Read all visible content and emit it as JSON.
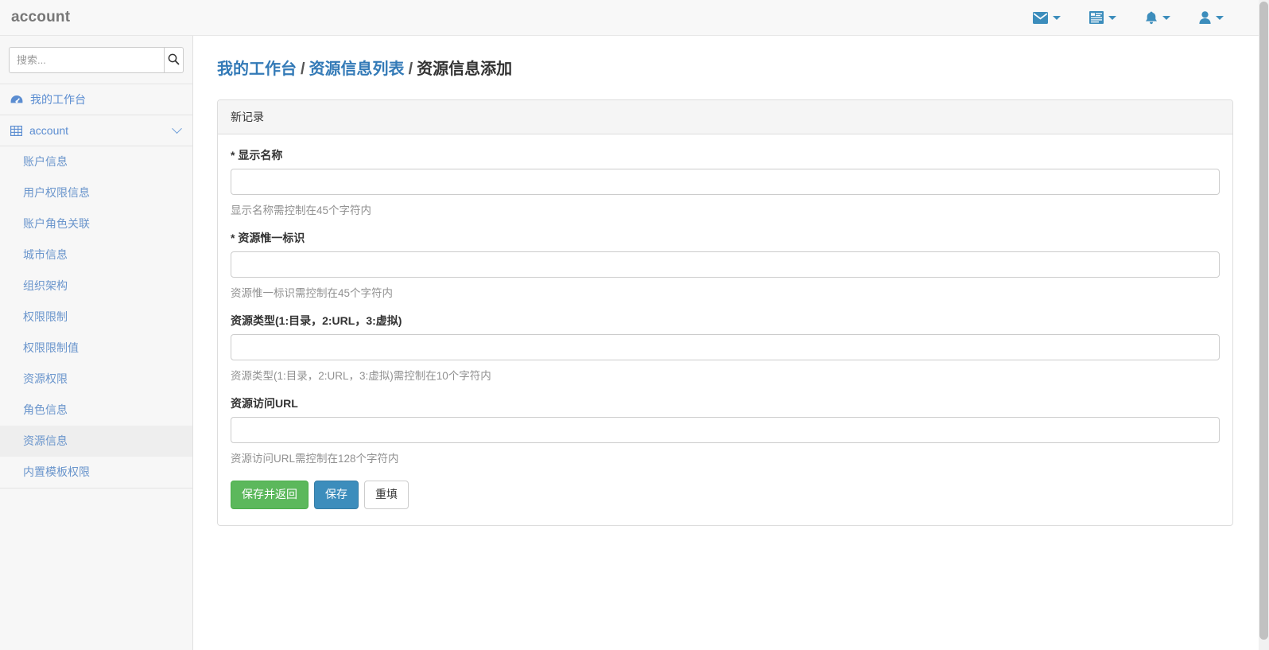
{
  "navbar": {
    "brand": "account",
    "items": [
      {
        "icon": "envelope-icon",
        "name": "messages-menu"
      },
      {
        "icon": "tasks-icon",
        "name": "tasks-menu"
      },
      {
        "icon": "bell-icon",
        "name": "notifications-menu"
      },
      {
        "icon": "user-icon",
        "name": "user-menu"
      }
    ]
  },
  "sidebar": {
    "search": {
      "placeholder": "搜索...",
      "value": "",
      "button_icon": "search-icon"
    },
    "dashboard": {
      "label": "我的工作台",
      "icon": "dashboard-icon"
    },
    "tree": {
      "label": "account",
      "icon": "table-icon",
      "chevron": "chevron-down-icon"
    },
    "items": [
      {
        "label": "账户信息",
        "active": false
      },
      {
        "label": "用户权限信息",
        "active": false
      },
      {
        "label": "账户角色关联",
        "active": false
      },
      {
        "label": "城市信息",
        "active": false
      },
      {
        "label": "组织架构",
        "active": false
      },
      {
        "label": "权限限制",
        "active": false
      },
      {
        "label": "权限限制值",
        "active": false
      },
      {
        "label": "资源权限",
        "active": false
      },
      {
        "label": "角色信息",
        "active": false
      },
      {
        "label": "资源信息",
        "active": true
      },
      {
        "label": "内置模板权限",
        "active": false
      }
    ]
  },
  "breadcrumb": {
    "item1": "我的工作台",
    "sep1": "/",
    "item2": "资源信息列表",
    "sep2": "/",
    "current": "资源信息添加"
  },
  "panel": {
    "heading": "新记录",
    "fields": [
      {
        "required_mark": "*",
        "label": "显示名称",
        "value": "",
        "help": "显示名称需控制在45个字符内"
      },
      {
        "required_mark": "*",
        "label": "资源惟一标识",
        "value": "",
        "help": "资源惟一标识需控制在45个字符内"
      },
      {
        "required_mark": "",
        "label": "资源类型(1:目录，2:URL，3:虚拟)",
        "value": "",
        "help": "资源类型(1:目录，2:URL，3:虚拟)需控制在10个字符内"
      },
      {
        "required_mark": "",
        "label": "资源访问URL",
        "value": "",
        "help": "资源访问URL需控制在128个字符内"
      }
    ],
    "buttons": {
      "save_return": "保存并返回",
      "save": "保存",
      "reset": "重填"
    }
  },
  "colors": {
    "link": "#337ab7",
    "sidebar_link": "#6a95cc",
    "success": "#5cb85c",
    "primary": "#3c8dbc",
    "navbar_bg": "#f8f8f8",
    "sidebar_bg": "#f7f7f7"
  }
}
